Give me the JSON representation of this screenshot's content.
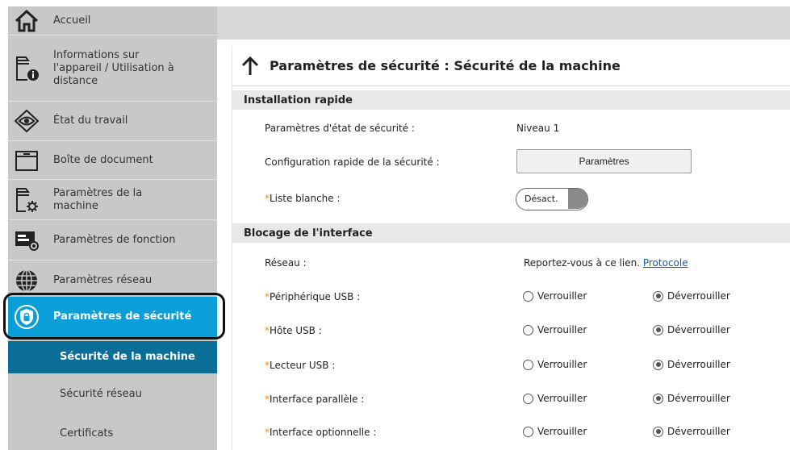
{
  "sidebar": {
    "items": [
      {
        "label": "Accueil",
        "icon": "home-icon"
      },
      {
        "label": "Informations sur l'appareil / Utilisation à distance",
        "icon": "device-info-icon"
      },
      {
        "label": "État du travail",
        "icon": "eye-icon"
      },
      {
        "label": "Boîte de document",
        "icon": "folder-icon"
      },
      {
        "label": "Paramètres de la machine",
        "icon": "machine-settings-icon"
      },
      {
        "label": "Paramètres de fonction",
        "icon": "function-settings-icon"
      },
      {
        "label": "Paramètres réseau",
        "icon": "globe-icon"
      },
      {
        "label": "Paramètres de sécurité",
        "icon": "shield-icon"
      }
    ],
    "sub_items": [
      {
        "label": "Sécurité de la machine"
      },
      {
        "label": "Sécurité réseau"
      },
      {
        "label": "Certificats"
      }
    ]
  },
  "header": {
    "title": "Paramètres de sécurité : Sécurité de la machine"
  },
  "sections": {
    "quick": {
      "title": "Installation rapide",
      "security_level_label": "Paramètres d'état de sécurité :",
      "security_level_value": "Niveau 1",
      "quick_config_label": "Configuration rapide de la sécurité :",
      "quick_config_button": "Paramètres",
      "whitelist_label": "Liste blanche :",
      "whitelist_state": "Désact."
    },
    "interface": {
      "title": "Blocage de l'interface",
      "network_label": "Réseau :",
      "network_text": "Reportez-vous à ce lien.",
      "network_link": "Protocole",
      "rows": [
        {
          "label": "Périphérique USB :",
          "lock": "Verrouiller",
          "unlock": "Déverrouiller"
        },
        {
          "label": "Hôte USB :",
          "lock": "Verrouiller",
          "unlock": "Déverrouiller"
        },
        {
          "label": "Lecteur USB :",
          "lock": "Verrouiller",
          "unlock": "Déverrouiller"
        },
        {
          "label": "Interface parallèle :",
          "lock": "Verrouiller",
          "unlock": "Déverrouiller"
        },
        {
          "label": "Interface optionnelle :",
          "lock": "Verrouiller",
          "unlock": "Déverrouiller"
        }
      ]
    }
  },
  "required_marker": "*",
  "colors": {
    "sidebar_bg": "#c8c8c8",
    "active_item": "#0a9fd8",
    "active_sub_item": "#0a6e96",
    "required_marker": "#f08a00",
    "link": "#1d56b5"
  }
}
